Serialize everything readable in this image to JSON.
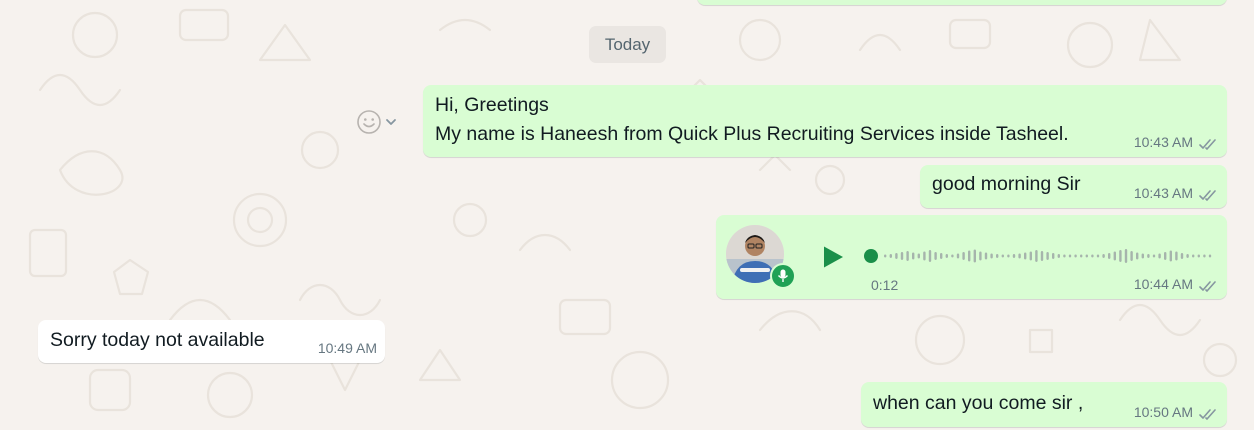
{
  "date_divider": "Today",
  "messages": [
    {
      "text_line1": "Hi, Greetings",
      "text_line2": "My name is Haneesh from Quick Plus Recruiting Services inside Tasheel.",
      "time": "10:43 AM"
    },
    {
      "text": "good morning Sir",
      "time": "10:43 AM"
    },
    {
      "duration": "0:12",
      "time": "10:44 AM",
      "played_fraction": 0.0
    },
    {
      "text": "Sorry today not available",
      "time": "10:49 AM"
    },
    {
      "text": "when can you come sir ,",
      "time": "10:50 AM"
    }
  ],
  "icons": {
    "read": "double-check-icon",
    "react": "smiley-icon",
    "menu": "chevron-down-icon",
    "play": "play-icon",
    "mic": "mic-icon"
  },
  "colors": {
    "background": "#f6f2ee",
    "outgoing_bubble": "#d9fdd3",
    "incoming_bubble": "#ffffff",
    "accent_green": "#20a155",
    "meta_text": "#667781"
  }
}
